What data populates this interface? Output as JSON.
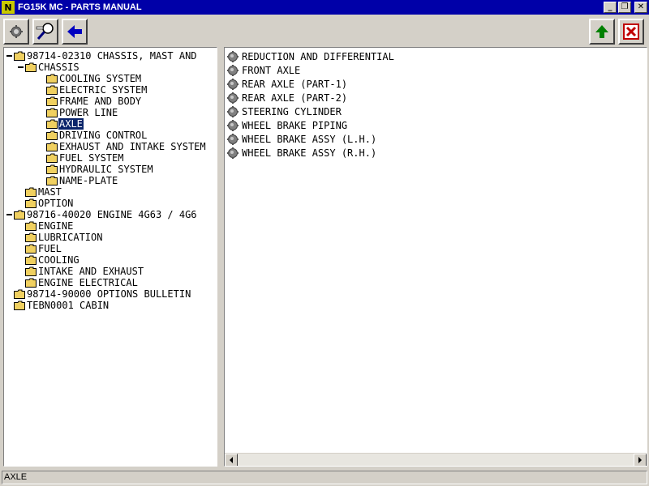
{
  "window": {
    "title": "FG15K MC - PARTS MANUAL",
    "app_icon_glyph": "N",
    "minimize_glyph": "_",
    "restore_glyph": "❐",
    "close_glyph": "✕"
  },
  "toolbar": {
    "left_buttons": [
      "gear-icon",
      "magnifier-search-icon",
      "back-arrow-icon"
    ],
    "right_buttons": [
      "up-arrow-icon",
      "close-x-icon"
    ],
    "colors": {
      "arrow_blue": "#0000c0",
      "up_green": "#008000",
      "close_red": "#c00000"
    }
  },
  "tree": {
    "items": [
      {
        "label": "98714-02310 CHASSIS, MAST AND",
        "expanded": true
      },
      {
        "label": "CHASSIS",
        "expanded": true
      },
      {
        "label": "COOLING SYSTEM"
      },
      {
        "label": "ELECTRIC SYSTEM"
      },
      {
        "label": "FRAME AND BODY"
      },
      {
        "label": "POWER LINE"
      },
      {
        "label": "AXLE",
        "selected": true
      },
      {
        "label": "DRIVING CONTROL"
      },
      {
        "label": "EXHAUST AND INTAKE SYSTEM"
      },
      {
        "label": "FUEL SYSTEM"
      },
      {
        "label": "HYDRAULIC SYSTEM"
      },
      {
        "label": "NAME-PLATE"
      },
      {
        "label": "MAST"
      },
      {
        "label": "OPTION"
      },
      {
        "label": "98716-40020 ENGINE 4G63 / 4G6",
        "expanded": true
      },
      {
        "label": "ENGINE"
      },
      {
        "label": "LUBRICATION"
      },
      {
        "label": "FUEL"
      },
      {
        "label": "COOLING"
      },
      {
        "label": "INTAKE AND EXHAUST"
      },
      {
        "label": "ENGINE ELECTRICAL"
      },
      {
        "label": "98714-90000 OPTIONS BULLETIN"
      },
      {
        "label": "TEBN0001 CABIN"
      }
    ]
  },
  "parts_list": {
    "items": [
      "REDUCTION AND DIFFERENTIAL",
      "FRONT AXLE",
      "REAR AXLE (PART-1)",
      "REAR AXLE (PART-2)",
      "STEERING CYLINDER",
      "WHEEL BRAKE PIPING",
      "WHEEL BRAKE ASSY (L.H.)",
      "WHEEL BRAKE ASSY (R.H.)"
    ]
  },
  "statusbar": {
    "text": "AXLE"
  },
  "colors": {
    "titlebar": "#0000a8",
    "selection": "#0a246a",
    "folder": "#f0d060",
    "chrome": "#d4d0c8"
  }
}
